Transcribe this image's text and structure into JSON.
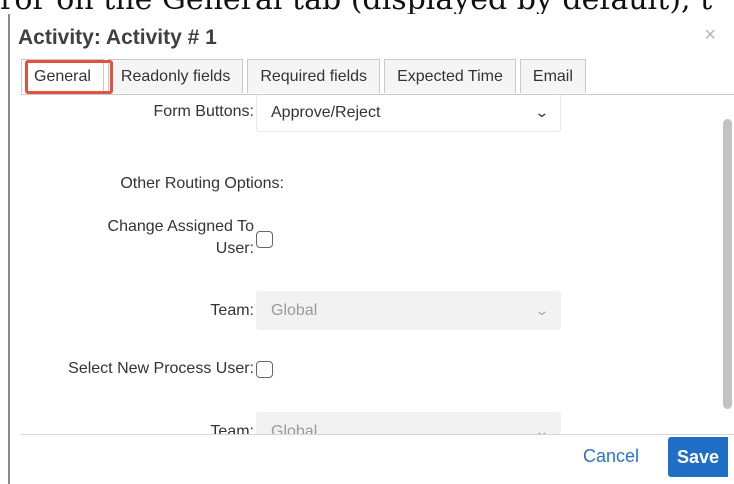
{
  "background": {
    "partial_text": "ror on the General tab (displayed by default), t"
  },
  "dialog": {
    "title": "Activity: Activity # 1",
    "close_icon": "×"
  },
  "tabs": [
    {
      "label": "General",
      "active": true
    },
    {
      "label": "Readonly fields",
      "active": false
    },
    {
      "label": "Required fields",
      "active": false
    },
    {
      "label": "Expected Time",
      "active": false
    },
    {
      "label": "Email",
      "active": false
    }
  ],
  "form": {
    "form_buttons": {
      "label": "Form Buttons:",
      "value": "Approve/Reject"
    },
    "other_routing": {
      "label": "Other Routing Options:"
    },
    "change_assigned": {
      "label_line1": "Change Assigned To",
      "label_line2": "User:",
      "checked": false
    },
    "team1": {
      "label": "Team:",
      "value": "Global"
    },
    "select_new_process_user": {
      "label": "Select New Process User:",
      "checked": false
    },
    "team2": {
      "label": "Team:",
      "value": "Global"
    }
  },
  "footer": {
    "cancel_label": "Cancel",
    "save_label": "Save"
  },
  "colors": {
    "highlight": "#e0533f",
    "primary": "#1f6fc7",
    "link": "#2a72c7"
  }
}
